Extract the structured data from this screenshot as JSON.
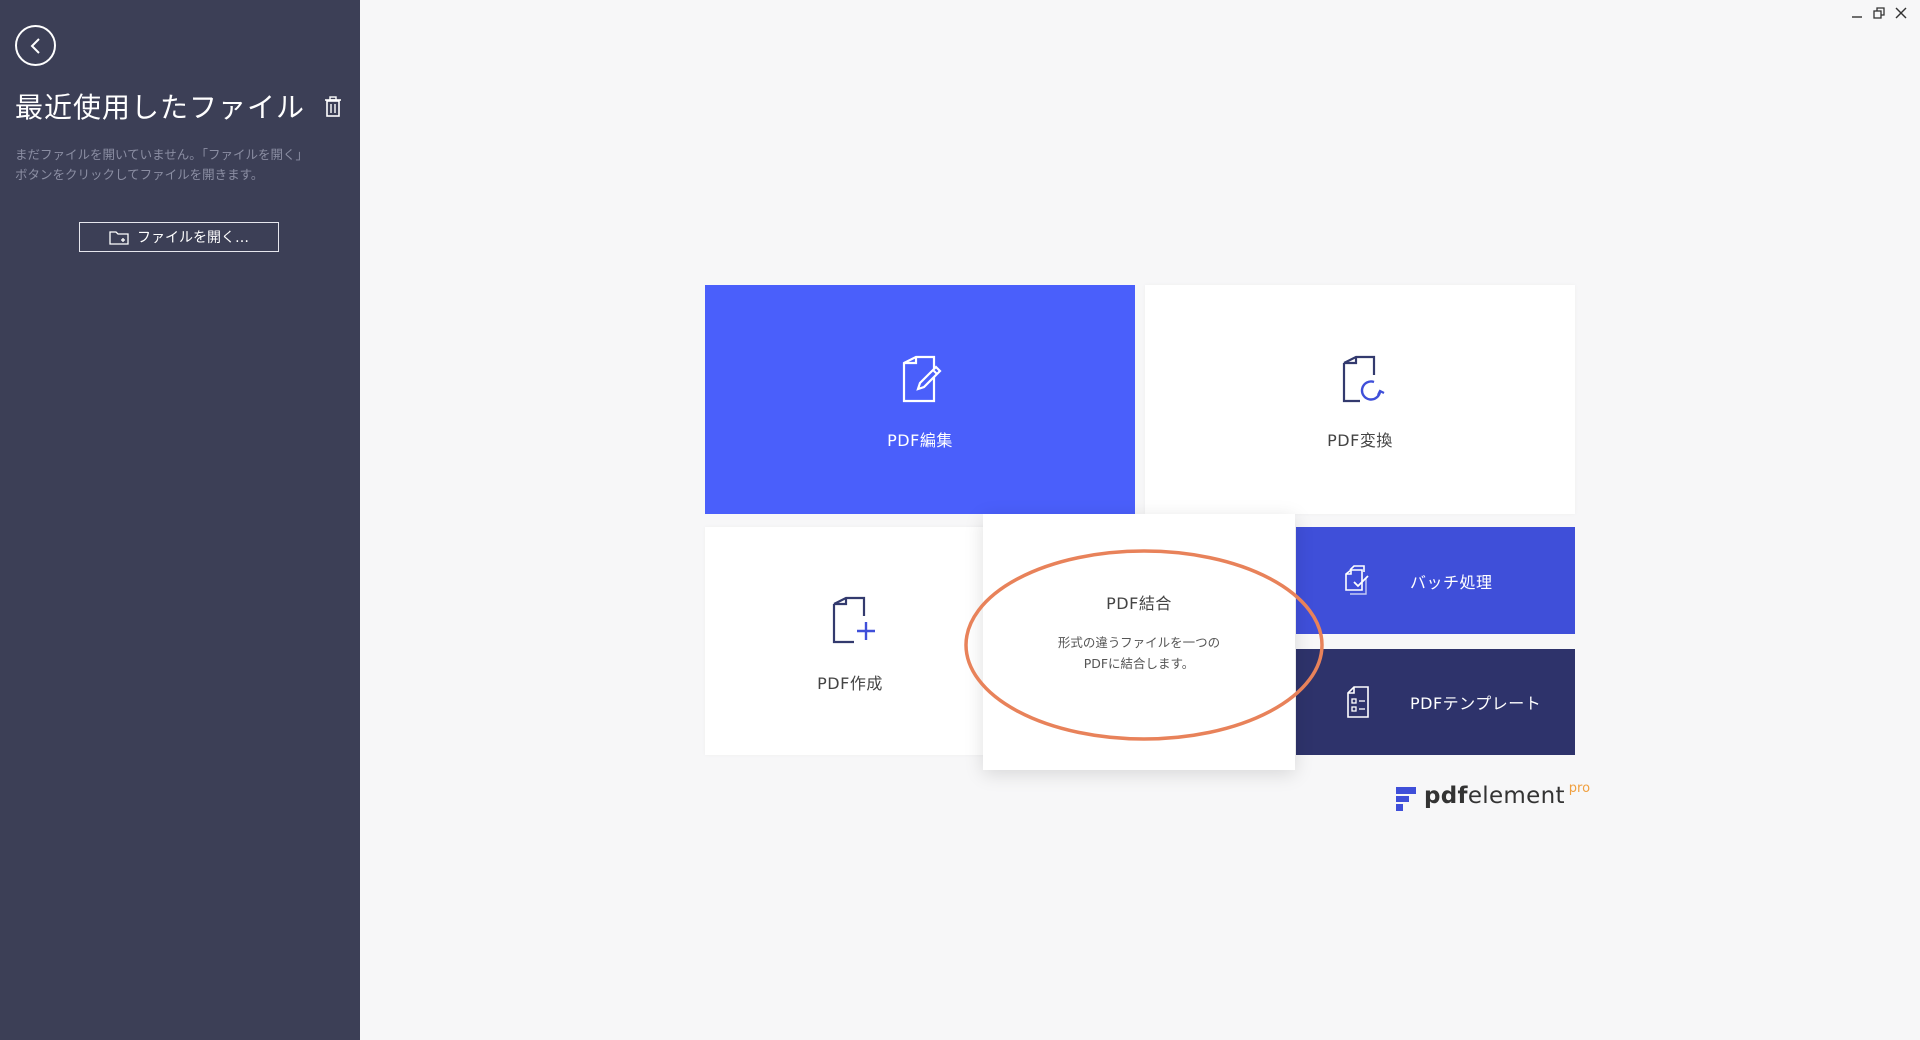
{
  "sidebar": {
    "title": "最近使用したファイル",
    "description": "まだファイルを開いていません。「ファイルを開く」ボタンをクリックしてファイルを開きます。",
    "open_button_label": "ファイルを開く…",
    "icons": {
      "back": "chevron-left-icon",
      "trash": "trash-icon",
      "folder": "folder-icon"
    }
  },
  "window_controls": {
    "icons": [
      "minimize-icon",
      "restore-icon",
      "close-icon"
    ]
  },
  "tiles": {
    "edit": {
      "label": "PDF編集",
      "icon": "edit-document-icon",
      "color": "#4a5ffb"
    },
    "convert": {
      "label": "PDF変換",
      "icon": "convert-document-icon",
      "color": "#ffffff"
    },
    "create": {
      "label": "PDF作成",
      "icon": "create-document-icon",
      "color": "#ffffff"
    },
    "combine": {
      "label": "PDF結合",
      "description_line1": "形式の違うファイルを一つの",
      "description_line2": "PDFに結合します。",
      "color": "#ffffff"
    },
    "batch": {
      "label": "バッチ処理",
      "icon": "batch-process-icon",
      "color": "#3f4fd9"
    },
    "template": {
      "label": "PDFテンプレート",
      "icon": "template-icon",
      "color": "#2e336b"
    }
  },
  "highlight": {
    "color": "#e8825a",
    "shape": "ellipse"
  },
  "brand": {
    "name_bold": "pdf",
    "name_regular": "element",
    "edition": "pro",
    "accent": "#f0a040"
  }
}
